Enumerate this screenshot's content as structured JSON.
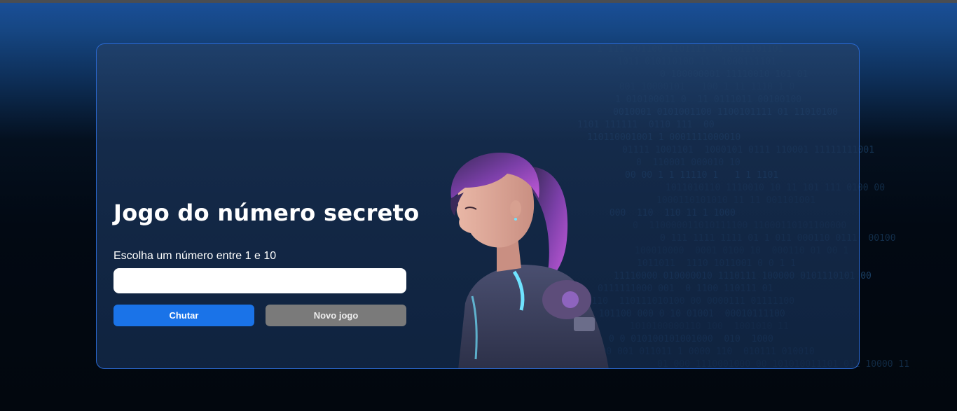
{
  "page": {
    "title": "Jogo do número secreto",
    "instruction": "Escolha um número entre 1 e 10",
    "input": {
      "value": "",
      "placeholder": ""
    },
    "buttons": {
      "guess": "Chutar",
      "new_game": "Novo jogo"
    },
    "illustration": "astronaut-girl-illustration",
    "background_pattern": "binary-code-rain"
  },
  "colors": {
    "accent": "#1a73e8",
    "secondary_button": "#7a7a7a",
    "card_border": "#2a68d0",
    "binary_text": "#1f4a74"
  }
}
